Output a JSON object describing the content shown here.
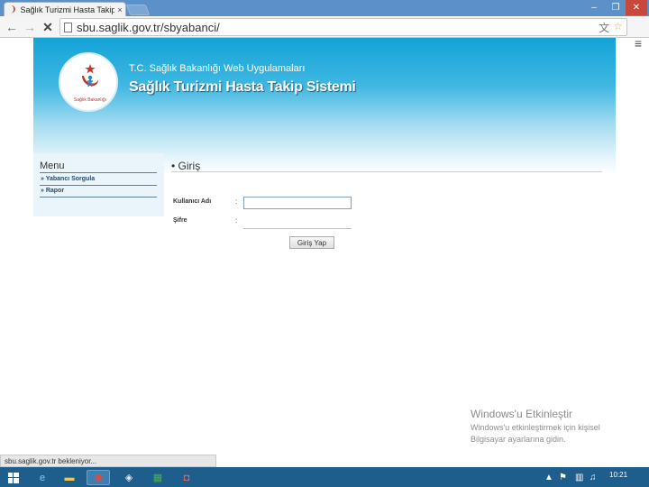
{
  "browser": {
    "tab_title": "Sağlık Turizmi Hasta Takip S",
    "tab_close": "×",
    "url": "sbu.saglik.gov.tr/sbyabanci/",
    "status_text": "sbu.saglik.gov.tr bekleniyor...",
    "window_controls": {
      "minimize": "–",
      "maximize": "❐",
      "close": "✕"
    },
    "icons": [
      "back-arrow",
      "forward-arrow",
      "stop-x",
      "translate",
      "star",
      "menu"
    ]
  },
  "header": {
    "logo_caption": "Sağlık Bakanlığı",
    "org_name": "T.C. Sağlık Bakanlığı Web Uygulamaları",
    "system_name": "Sağlık Turizmi Hasta Takip Sistemi"
  },
  "menu": {
    "title": "Menu",
    "items": [
      {
        "label": "» Yabancı Sorgula"
      },
      {
        "label": "» Rapor"
      }
    ]
  },
  "login": {
    "section_title": "• Giriş",
    "username_label": "Kullanıcı Adı",
    "password_label": "Şifre",
    "colon": ":",
    "username_value": "",
    "password_value": "",
    "submit_label": "Giriş Yap"
  },
  "activation": {
    "title": "Windows'u Etkinleştir",
    "line1": "Windows'u etkinleştirmek için kişisel",
    "line2": "Bilgisayar ayarlarına gidin."
  },
  "taskbar": {
    "clock": "10:21"
  },
  "colors": {
    "banner_top": "#14a3d7",
    "titlebar": "#5c90c8",
    "taskbar": "#1d5e8c",
    "menu_panel": "#eaf5fb"
  }
}
